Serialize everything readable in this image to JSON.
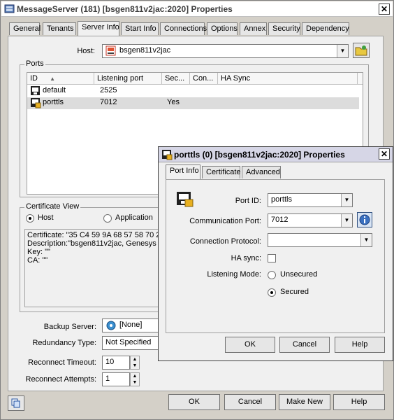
{
  "main": {
    "title": "MessageServer (181) [bsgen811v2jac:2020] Properties",
    "tabs": [
      "General",
      "Tenants",
      "Server Info",
      "Start Info",
      "Connections",
      "Options",
      "Annex",
      "Security",
      "Dependency"
    ],
    "active_tab": "Server Info",
    "host_label": "Host:",
    "host_value": "bsgen811v2jac",
    "ports_group": "Ports",
    "ports_columns": [
      "ID",
      "Listening port",
      "Sec...",
      "Con...",
      "HA Sync"
    ],
    "ports_rows": [
      {
        "id": "default",
        "port": "2525",
        "secured": "",
        "con": "",
        "ha": ""
      },
      {
        "id": "porttls",
        "port": "7012",
        "secured": "Yes",
        "con": "",
        "ha": ""
      }
    ],
    "cert_group": "Certificate View",
    "cert_radio_host": "Host",
    "cert_radio_app": "Application",
    "cert_lines": [
      "Certificate: \"35 C4 59 9A 68 57 58 70 21",
      "Description:\"bsgen811v2jac, Genesys QA",
      "Key: \"\"",
      "CA: \"\""
    ],
    "backup_label": "Backup Server:",
    "backup_value": "[None]",
    "redundancy_label": "Redundancy Type:",
    "redundancy_value": "Not Specified",
    "reconnect_timeout_label": "Reconnect Timeout:",
    "reconnect_timeout_value": "10",
    "reconnect_attempts_label": "Reconnect Attempts:",
    "reconnect_attempts_value": "1",
    "buttons": {
      "ok": "OK",
      "cancel": "Cancel",
      "make_new": "Make New",
      "help": "Help"
    }
  },
  "dialog": {
    "title": "porttls (0) [bsgen811v2jac:2020] Properties",
    "tabs": [
      "Port Info",
      "Certificate",
      "Advanced"
    ],
    "active_tab": "Port Info",
    "port_id_label": "Port ID:",
    "port_id_value": "porttls",
    "comm_port_label": "Communication Port:",
    "comm_port_value": "7012",
    "conn_protocol_label": "Connection Protocol:",
    "conn_protocol_value": "",
    "ha_sync_label": "HA sync:",
    "listening_mode_label": "Listening Mode:",
    "mode_unsecured": "Unsecured",
    "mode_secured": "Secured",
    "selected_mode": "Secured",
    "buttons": {
      "ok": "OK",
      "cancel": "Cancel",
      "help": "Help"
    }
  },
  "colors": {
    "accent": "#000080",
    "selected_row": "#dcdcdc",
    "window_bg": "#f0f0f0"
  }
}
